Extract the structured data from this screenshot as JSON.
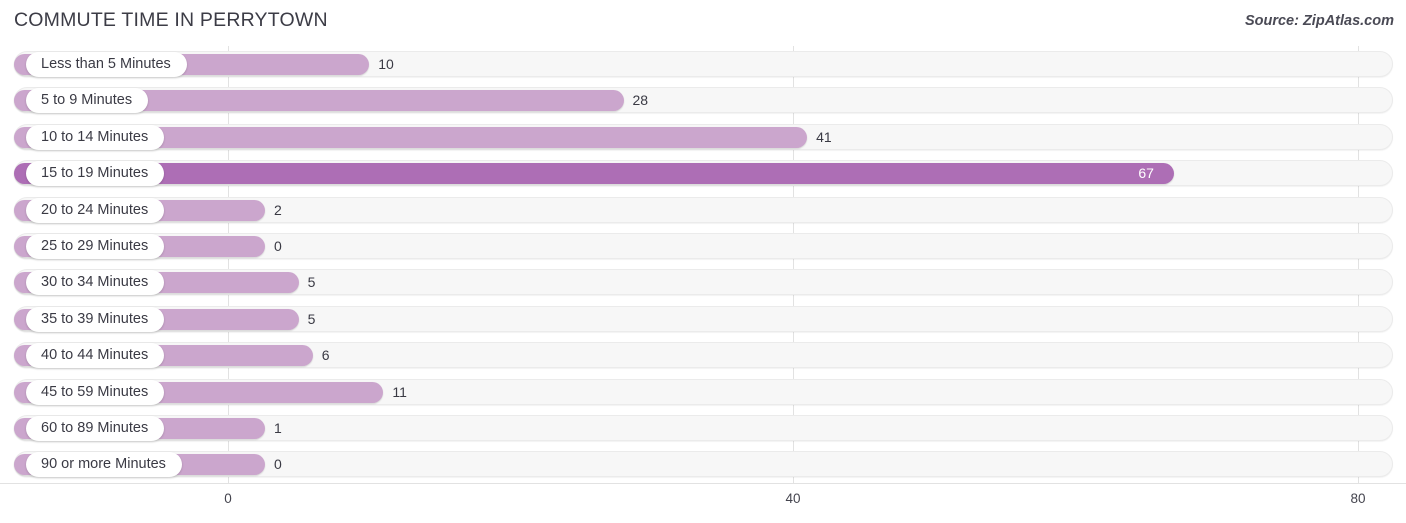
{
  "header": {
    "title": "COMMUTE TIME IN PERRYTOWN",
    "source": "Source: ZipAtlas.com"
  },
  "colors": {
    "bar": "#cba6cd",
    "bar_highlight": "#ad6eb5",
    "track": "#f7f7f7",
    "gridline": "#e2e2e2",
    "text": "#3a3a44"
  },
  "chart_data": {
    "type": "bar",
    "orientation": "horizontal",
    "title": "COMMUTE TIME IN PERRYTOWN",
    "xlabel": "",
    "ylabel": "",
    "xlim": [
      0,
      80
    ],
    "xticks": [
      "0",
      "40",
      "80"
    ],
    "xtick_values": [
      0,
      40,
      80
    ],
    "grid": true,
    "legend": null,
    "categories": [
      "Less than 5 Minutes",
      "5 to 9 Minutes",
      "10 to 14 Minutes",
      "15 to 19 Minutes",
      "20 to 24 Minutes",
      "25 to 29 Minutes",
      "30 to 34 Minutes",
      "35 to 39 Minutes",
      "40 to 44 Minutes",
      "45 to 59 Minutes",
      "60 to 89 Minutes",
      "90 or more Minutes"
    ],
    "values": [
      10,
      28,
      41,
      67,
      2,
      0,
      5,
      5,
      6,
      11,
      1,
      0
    ],
    "value_labels": [
      "10",
      "28",
      "41",
      "67",
      "2",
      "0",
      "5",
      "5",
      "6",
      "11",
      "1",
      "0"
    ],
    "max_value": 67,
    "highlight_index": 3
  },
  "rows": [
    {
      "label": "Less than 5 Minutes",
      "value": 10,
      "value_label": "10"
    },
    {
      "label": "5 to 9 Minutes",
      "value": 28,
      "value_label": "28"
    },
    {
      "label": "10 to 14 Minutes",
      "value": 41,
      "value_label": "41"
    },
    {
      "label": "15 to 19 Minutes",
      "value": 67,
      "value_label": "67"
    },
    {
      "label": "20 to 24 Minutes",
      "value": 2,
      "value_label": "2"
    },
    {
      "label": "25 to 29 Minutes",
      "value": 0,
      "value_label": "0"
    },
    {
      "label": "30 to 34 Minutes",
      "value": 5,
      "value_label": "5"
    },
    {
      "label": "35 to 39 Minutes",
      "value": 5,
      "value_label": "5"
    },
    {
      "label": "40 to 44 Minutes",
      "value": 6,
      "value_label": "6"
    },
    {
      "label": "45 to 59 Minutes",
      "value": 11,
      "value_label": "11"
    },
    {
      "label": "60 to 89 Minutes",
      "value": 1,
      "value_label": "1"
    },
    {
      "label": "90 or more Minutes",
      "value": 0,
      "value_label": "0"
    }
  ],
  "axis": {
    "ticks": [
      {
        "label": "0",
        "value": 0
      },
      {
        "label": "40",
        "value": 40
      },
      {
        "label": "80",
        "value": 80
      }
    ]
  }
}
